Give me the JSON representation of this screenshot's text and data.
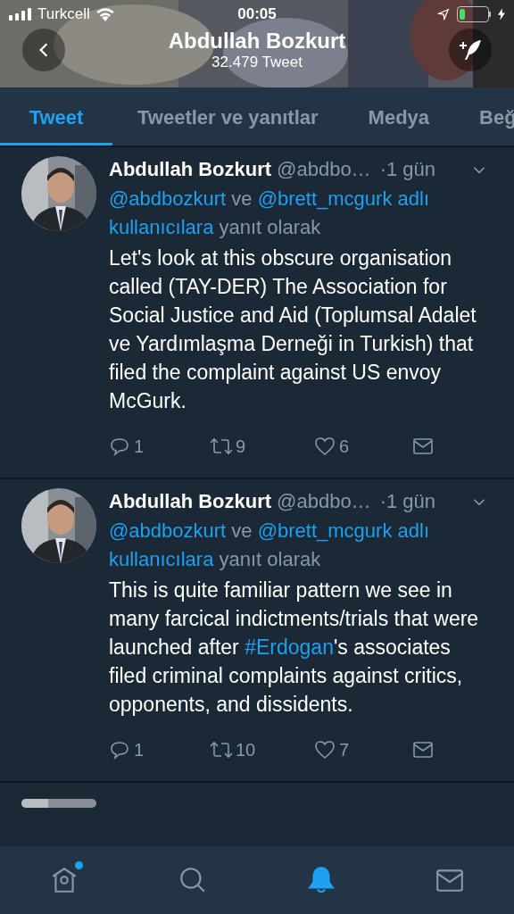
{
  "status_bar": {
    "carrier": "Turkcell",
    "time": "00:05"
  },
  "header": {
    "title": "Abdullah Bozkurt",
    "subtitle": "32.479 Tweet"
  },
  "tabs": [
    {
      "label": "Tweet",
      "selected": true
    },
    {
      "label": "Tweetler ve yanıtlar",
      "selected": false
    },
    {
      "label": "Medya",
      "selected": false
    },
    {
      "label": "Beğ",
      "selected": false
    }
  ],
  "tweets": [
    {
      "name": "Abdullah Bozkurt",
      "handle": "@abdbo…",
      "time": "·1 gün",
      "reply_to": [
        {
          "kind": "link",
          "text": "@abdbozkurt"
        },
        {
          "kind": "text",
          "text": "ve"
        },
        {
          "kind": "link",
          "text": "@brett_mcgurk"
        },
        {
          "kind": "link",
          "text": "adlı kullanıcılara"
        },
        {
          "kind": "text",
          "text": "yanıt olarak"
        }
      ],
      "body": [
        {
          "kind": "text",
          "text": "Let's look at this obscure organisation called (TAY-DER) The Association for Social Justice and Aid (Toplumsal Adalet ve Yardımlaşma Derneği in Turkish) that filed the complaint against US envoy McGurk."
        }
      ],
      "replies": "1",
      "retweets": "9",
      "likes": "6"
    },
    {
      "name": "Abdullah Bozkurt",
      "handle": "@abdbo…",
      "time": "·1 gün",
      "reply_to": [
        {
          "kind": "link",
          "text": "@abdbozkurt"
        },
        {
          "kind": "text",
          "text": "ve"
        },
        {
          "kind": "link",
          "text": "@brett_mcgurk"
        },
        {
          "kind": "link",
          "text": "adlı kullanıcılara"
        },
        {
          "kind": "text",
          "text": "yanıt olarak"
        }
      ],
      "body": [
        {
          "kind": "text",
          "text": "This is quite familiar pattern we see in many farcical indictments/trials that were launched after"
        },
        {
          "kind": "link",
          "text": "#Erdogan"
        },
        {
          "kind": "text",
          "text": "'s associates filed criminal complaints against critics, opponents, and dissidents."
        }
      ],
      "replies": "1",
      "retweets": "10",
      "likes": "7"
    }
  ],
  "tab_bar": [
    {
      "kind": "home",
      "selected": false,
      "badge": true
    },
    {
      "kind": "search",
      "selected": false,
      "badge": false
    },
    {
      "kind": "notifications",
      "selected": true,
      "badge": false
    },
    {
      "kind": "messages",
      "selected": false,
      "badge": false
    }
  ]
}
